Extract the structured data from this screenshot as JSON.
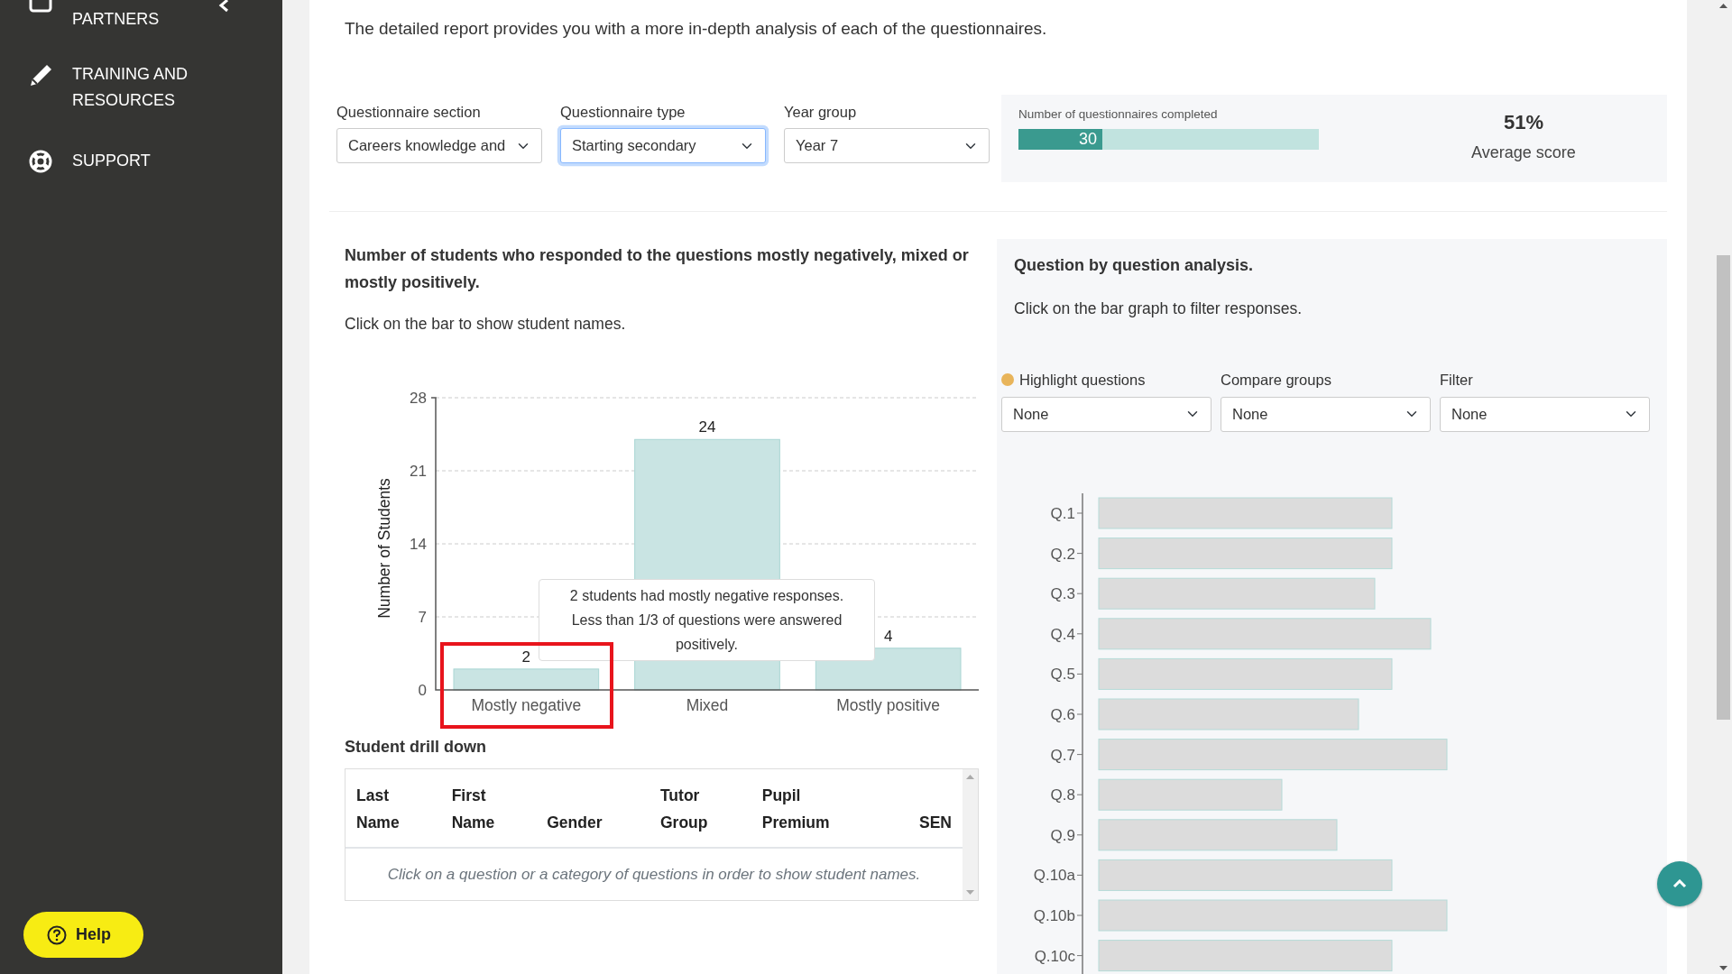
{
  "sidebar": {
    "items": [
      {
        "label": "PARTNERS"
      },
      {
        "label": "TRAINING AND RESOURCES"
      },
      {
        "label": "SUPPORT"
      }
    ],
    "help_button": {
      "label": "Help"
    }
  },
  "intro": "The detailed report provides you with a more in-depth analysis of each of the questionnaires.",
  "filters": [
    {
      "label": "Questionnaire section",
      "value": "Careers knowledge and",
      "focused": false
    },
    {
      "label": "Questionnaire type",
      "value": "Starting secondary",
      "focused": true
    },
    {
      "label": "Year group",
      "value": "Year 7",
      "focused": false
    }
  ],
  "completed": {
    "label": "Number of questionnaires completed",
    "value": "30",
    "level": 0.28
  },
  "average": {
    "value": "51%",
    "label": "Average score"
  },
  "responses": {
    "title": "Number of students who responded to the questions mostly negatively, mixed or mostly positively.",
    "hint": "Click on the bar to show student names.",
    "chart_data": {
      "type": "bar",
      "ylabel": "Number of Students",
      "categories": [
        "Mostly negative",
        "Mixed",
        "Mostly positive"
      ],
      "series": [
        {
          "color": "#c9e4e3",
          "values": [
            2,
            24,
            4
          ]
        }
      ],
      "ylim": [
        0,
        28
      ],
      "yticks": [
        0,
        7,
        14,
        21,
        28
      ],
      "data_labels": true,
      "grid": true
    },
    "tooltip": "2 students had mostly negative responses. Less than 1/3 of questions were answered positively."
  },
  "drill_down": {
    "title": "Student drill down",
    "columns": [
      "Last Name",
      "First Name",
      "Gender",
      "Tutor Group",
      "Pupil Premium",
      "SEN"
    ],
    "empty_message": "Click on a question or a category of questions in order to show student names."
  },
  "question_analysis": {
    "title": "Question by question analysis.",
    "hint": "Click on the bar graph to filter responses.",
    "controls": [
      {
        "label": "Highlight questions",
        "value": "None",
        "kind": "dot"
      },
      {
        "label": "Compare groups",
        "value": "None",
        "kind": "plain"
      },
      {
        "label": "Filter",
        "value": "None",
        "kind": "plain"
      }
    ],
    "questions": [
      "Q.1",
      "Q.2",
      "Q.3",
      "Q.4",
      "Q.5",
      "Q.6",
      "Q.7",
      "Q.8",
      "Q.9",
      "Q.10a",
      "Q.10b",
      "Q.10c"
    ]
  }
}
